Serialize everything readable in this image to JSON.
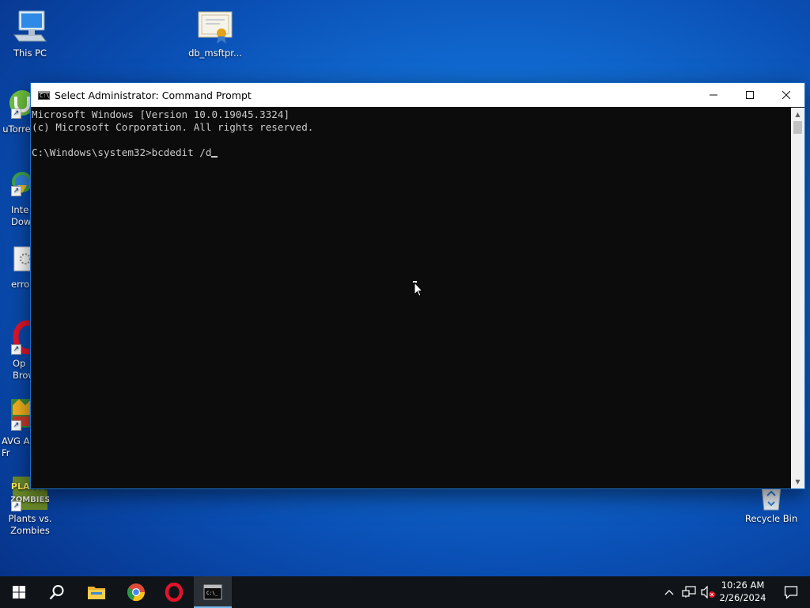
{
  "desktop": {
    "icons": [
      {
        "label": "This PC",
        "icon": "computer-icon"
      },
      {
        "label": "db_msftpr...",
        "icon": "certificate-icon"
      },
      {
        "label": "uTorre",
        "icon": "utorrent-icon"
      },
      {
        "label": "Inte\nDow",
        "icon": "download-manager-icon"
      },
      {
        "label": "erro",
        "icon": "gear-file-icon"
      },
      {
        "label": "Op\nBrow",
        "icon": "opera-icon"
      },
      {
        "label": "AVG An\nFr",
        "icon": "avg-antivirus-icon"
      },
      {
        "label": "Plants vs.\nZombies",
        "icon": "plants-vs-zombies-icon"
      },
      {
        "label": "Recycle Bin",
        "icon": "recycle-bin-icon"
      }
    ]
  },
  "window": {
    "title": "Select Administrator: Command Prompt",
    "controls": [
      "minimize",
      "maximize",
      "close"
    ],
    "console": {
      "lines": [
        "Microsoft Windows [Version 10.0.19045.3324]",
        "(c) Microsoft Corporation. All rights reserved.",
        "",
        "C:\\Windows\\system32>bcdedit /d"
      ]
    }
  },
  "taskbar": {
    "apps": [
      "start-icon",
      "search-icon",
      "file-explorer-icon",
      "chrome-icon",
      "opera-icon",
      "command-prompt-icon"
    ],
    "tray": {
      "time": "10:26 AM",
      "date": "2/26/2024"
    }
  },
  "colors": {
    "console_bg": "#0c0c0c",
    "console_text": "#cccccc",
    "taskbar_bg": "#101418",
    "accent": "#76b9ed"
  }
}
